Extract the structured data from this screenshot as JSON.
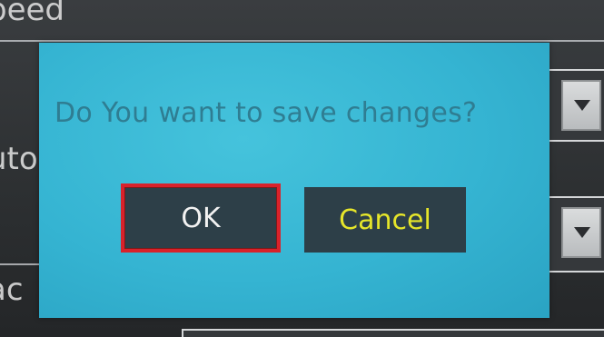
{
  "background": {
    "label_top": "peed",
    "label_mid": "uto",
    "label_bottom": "ac"
  },
  "dialog": {
    "message": "Do You want to save changes?",
    "ok_label": "OK",
    "cancel_label": "Cancel"
  },
  "colors": {
    "dialog_bg": "#35b4d2",
    "message_text": "#2f7d92",
    "button_bg": "#2d3f48",
    "ok_text": "#f2f2f2",
    "cancel_text": "#e6e62a",
    "focus_border": "#d8222b"
  },
  "icons": {
    "dropdown": "triangle-down-icon"
  }
}
